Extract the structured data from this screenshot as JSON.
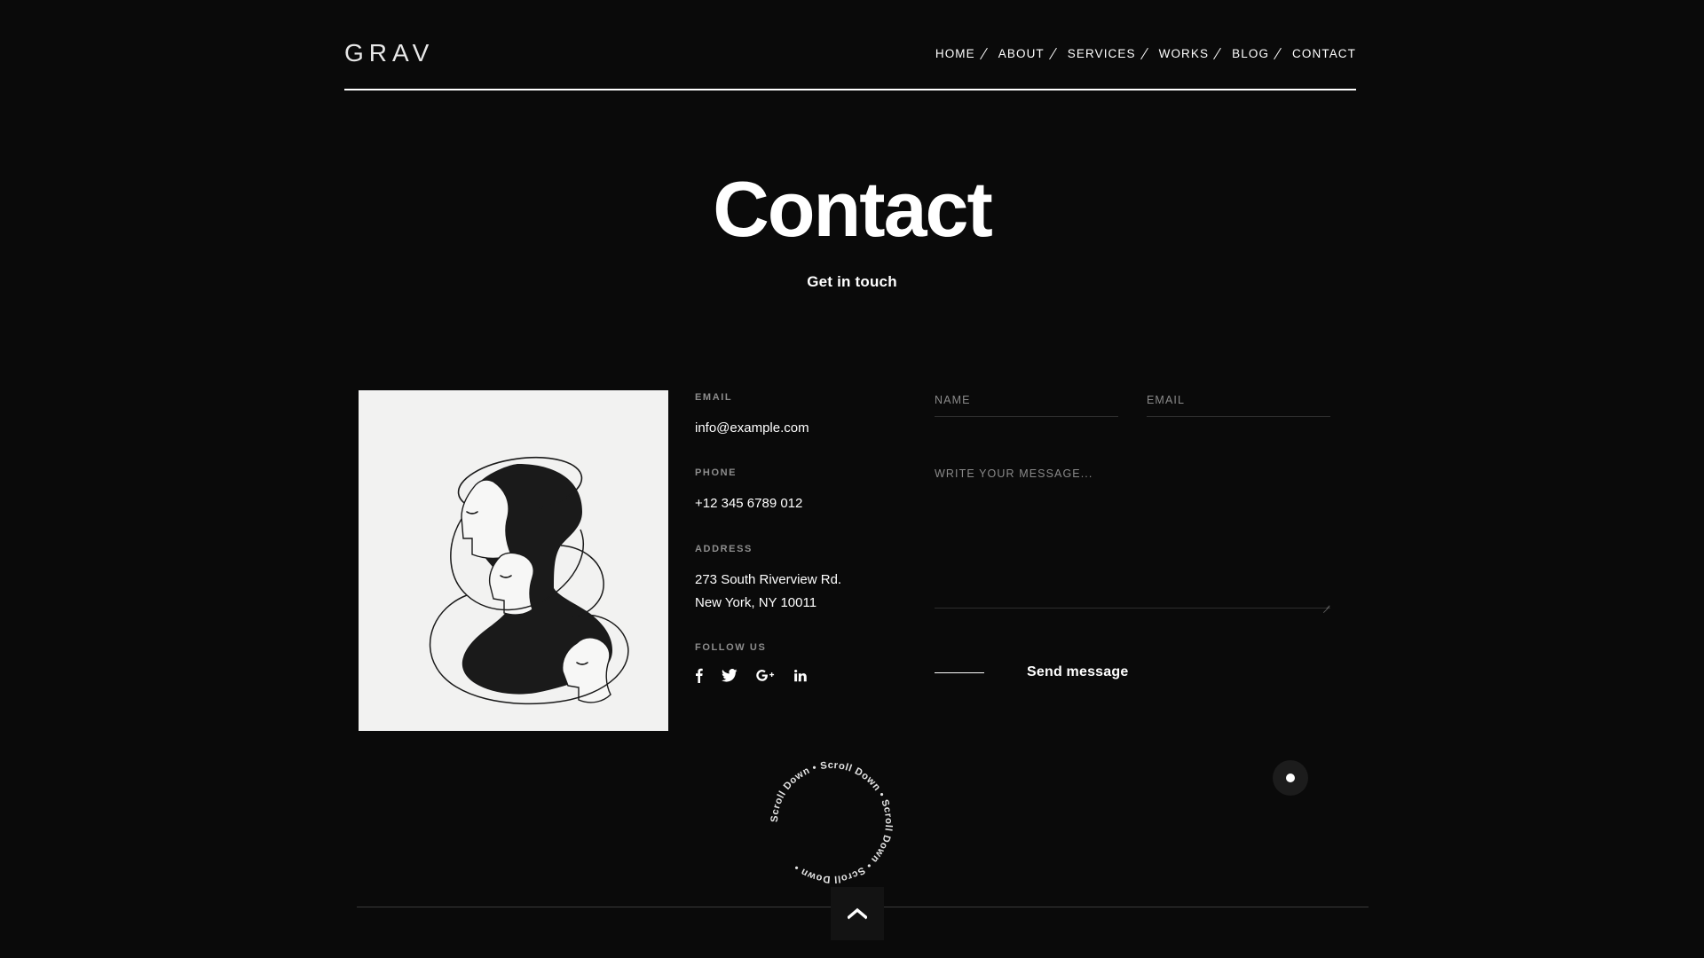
{
  "header": {
    "logo": "GRAV",
    "nav": [
      {
        "label": "HOME"
      },
      {
        "label": "ABOUT"
      },
      {
        "label": "SERVICES"
      },
      {
        "label": "WORKS"
      },
      {
        "label": "BLOG"
      },
      {
        "label": "CONTACT"
      }
    ]
  },
  "hero": {
    "title": "Contact",
    "subtitle": "Get in touch"
  },
  "info": {
    "email_label": "EMAIL",
    "email_value": "info@example.com",
    "phone_label": "PHONE",
    "phone_value": "+12 345 6789 012",
    "address_label": "ADDRESS",
    "address_line1": "273 South Riverview Rd.",
    "address_line2": "New York, NY 10011",
    "follow_label": "FOLLOW US",
    "socials": [
      {
        "name": "facebook"
      },
      {
        "name": "twitter"
      },
      {
        "name": "google-plus"
      },
      {
        "name": "linkedin"
      }
    ]
  },
  "form": {
    "name_placeholder": "NAME",
    "name_value": "",
    "email_placeholder": "EMAIL",
    "email_value": "",
    "message_placeholder": "WRITE YOUR MESSAGE...",
    "message_value": "",
    "submit_label": "Send message"
  },
  "scroll": {
    "circle_text": "Scroll Down • Scroll Down • Scroll Down • Scroll Down • ",
    "top_icon": "chevron-up-icon"
  },
  "float_button": {
    "icon": "dot-icon"
  },
  "colors": {
    "background": "#0a0a0a",
    "text": "#ffffff",
    "muted": "#8d8d8d",
    "rule": "#ffffff",
    "footer_rule": "#3a3a3a",
    "artwork_bg": "#f2f2f1"
  }
}
